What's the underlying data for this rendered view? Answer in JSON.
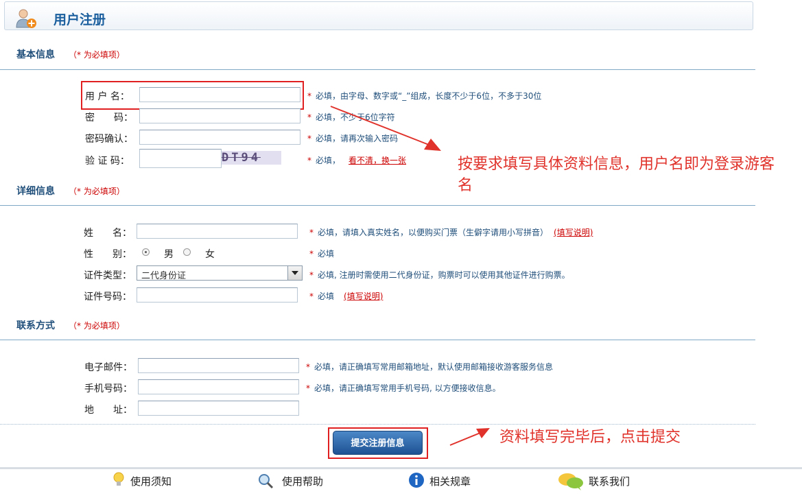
{
  "header": {
    "title": "用户注册"
  },
  "sections": {
    "basic": {
      "title": "基本信息",
      "note": "（* 为必填项）"
    },
    "detail": {
      "title": "详细信息",
      "note": "（* 为必填项）"
    },
    "contact": {
      "title": "联系方式",
      "note": "（* 为必填项）"
    }
  },
  "basic": {
    "username": {
      "label": "用 户 名：",
      "hint": "必填，由字母、数字或“_”组成，长度不少于6位，不多于30位"
    },
    "password": {
      "label": "密　　码：",
      "hint": "必填，不少于6位字符"
    },
    "confirm": {
      "label": "密码确认：",
      "hint": "必填，请再次输入密码"
    },
    "captcha": {
      "label": "验 证 码：",
      "hint": "必填，",
      "image_text": "DT94",
      "refresh": "看不清，换一张"
    }
  },
  "detail": {
    "name": {
      "label": "姓　　名：",
      "hint": "必填，请填入真实姓名，以便购买门票（生僻字请用小写拼音）",
      "link": "(填写说明)"
    },
    "gender": {
      "label": "性　　别：",
      "male": "男",
      "female": "女",
      "selected": "male",
      "hint": "必填"
    },
    "id_type": {
      "label": "证件类型：",
      "value": "二代身份证",
      "hint": "必填, 注册时需使用二代身份证，购票时可以使用其他证件进行购票。"
    },
    "id_number": {
      "label": "证件号码：",
      "hint": "必填",
      "link": "(填写说明)"
    }
  },
  "contact": {
    "email": {
      "label": "电子邮件：",
      "hint": "必填，请正确填写常用邮箱地址，默认使用邮箱接收游客服务信息"
    },
    "phone": {
      "label": "手机号码：",
      "hint": "必填，请正确填写常用手机号码, 以方便接收信息。"
    },
    "address": {
      "label": "地　　址："
    }
  },
  "star": "*",
  "submit": {
    "label": "提交注册信息"
  },
  "annotations": {
    "fill": "按要求填写具体资料信息，用户名即为登录游客名",
    "submit": "资料填写完毕后，点击提交"
  },
  "footer": {
    "items": [
      {
        "label": "使用须知",
        "icon": "lightbulb-icon"
      },
      {
        "label": "使用帮助",
        "icon": "magnifier-icon"
      },
      {
        "label": "相关规章",
        "icon": "info-icon"
      },
      {
        "label": "联系我们",
        "icon": "chat-bubbles-icon"
      }
    ]
  },
  "colors": {
    "accent": "#1b5f9e",
    "required": "#cc0000",
    "annotation": "#e0322a",
    "button": "#1d5293"
  }
}
